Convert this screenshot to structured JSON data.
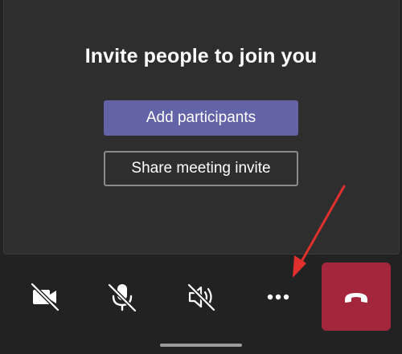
{
  "invite": {
    "title": "Invite people to join you",
    "add_participants_label": "Add participants",
    "share_invite_label": "Share meeting invite"
  },
  "toolbar": {
    "items": [
      {
        "name": "camera-off",
        "icon": "video-off-icon"
      },
      {
        "name": "mic-muted",
        "icon": "mic-off-icon"
      },
      {
        "name": "speaker-off",
        "icon": "speaker-off-icon"
      },
      {
        "name": "more-options",
        "icon": "more-horizontal-icon"
      },
      {
        "name": "end-call",
        "icon": "phone-hangup-icon"
      }
    ]
  },
  "colors": {
    "background": "#222222",
    "panel": "#2e2e2e",
    "primary_button": "#6264a7",
    "hangup_button": "#a4263d",
    "annotation_arrow": "#e0302e"
  }
}
